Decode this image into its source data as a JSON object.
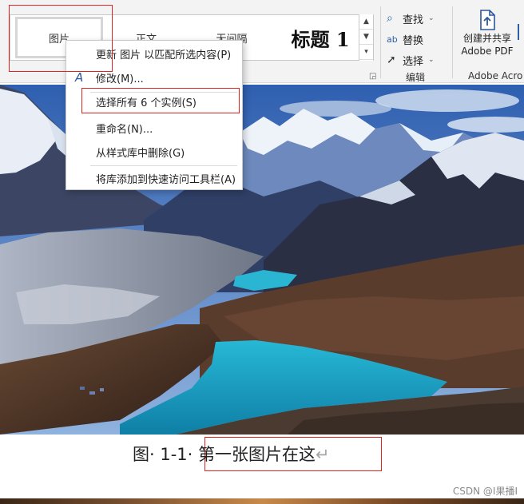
{
  "ribbon": {
    "styles": {
      "picture": "图片",
      "body": "正文",
      "no_spacing": "无间隔",
      "heading1": "标题 1"
    },
    "editing": {
      "find": "查找",
      "replace": "替换",
      "select": "选择",
      "group_label": "编辑"
    },
    "adobe": {
      "button_line1": "创建并共享",
      "button_line2": "Adobe PDF",
      "group_label": "Adobe Acro"
    }
  },
  "context_menu": {
    "items": [
      {
        "label": "更新 图片 以匹配所选内容(P)"
      },
      {
        "label": "修改(M)..."
      },
      {
        "label": "选择所有 6 个实例(S)"
      },
      {
        "label": "重命名(N)..."
      },
      {
        "label": "从样式库中删除(G)"
      },
      {
        "label": "将库添加到快速访问工具栏(A)"
      }
    ]
  },
  "caption": {
    "prefix": "图· 1-1· ",
    "text": "第一张图片在这",
    "mark": "↵"
  },
  "watermark": "CSDN @I果播I",
  "colors": {
    "accent": "#2b579a",
    "annotation": "#e02424",
    "lake": "#1fa9c9"
  }
}
